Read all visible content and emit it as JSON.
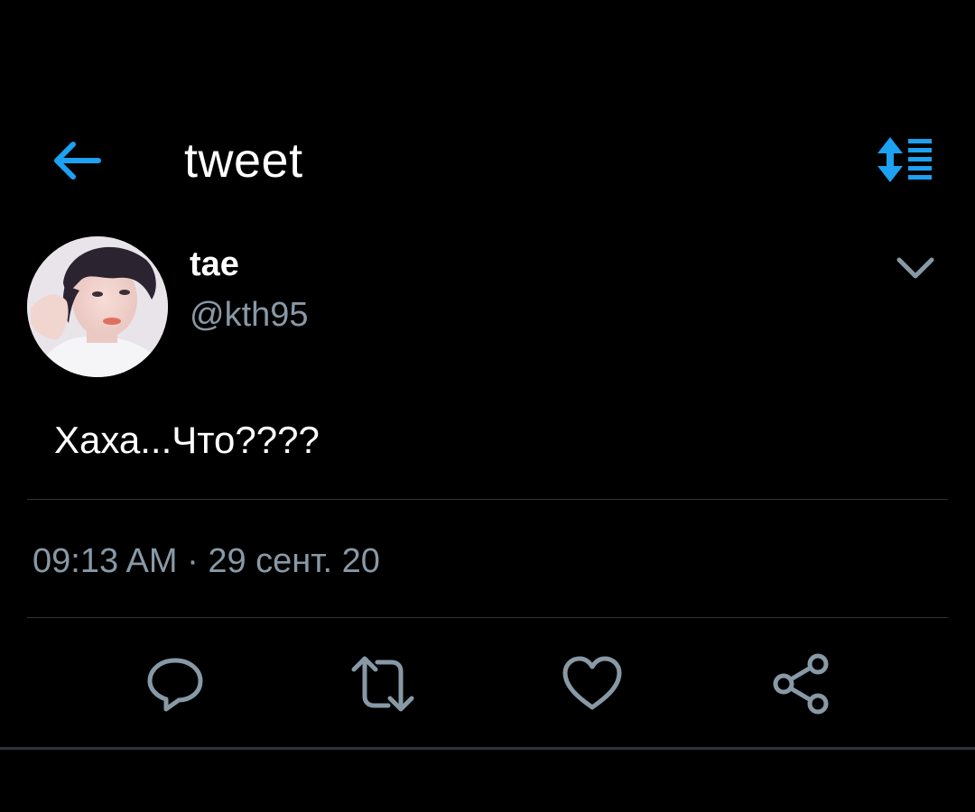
{
  "header": {
    "title": "tweet",
    "back_icon": "arrow-left-icon",
    "sort_icon": "sort-list-icon"
  },
  "tweet": {
    "author": {
      "display_name": "tae",
      "handle": "@kth95",
      "avatar_icon": "avatar-photo"
    },
    "text": "Хаха...Что????",
    "timestamp": "09:13 AM · 29 сент. 20"
  },
  "actions": [
    {
      "name": "reply",
      "icon": "comment-icon"
    },
    {
      "name": "retweet",
      "icon": "retweet-icon"
    },
    {
      "name": "like",
      "icon": "heart-icon"
    },
    {
      "name": "share",
      "icon": "share-icon"
    }
  ],
  "colors": {
    "background": "#000000",
    "accent": "#1da1f2",
    "secondary_text": "#8899a6",
    "icon_gray": "#8899a6",
    "divider": "#2f3336"
  }
}
